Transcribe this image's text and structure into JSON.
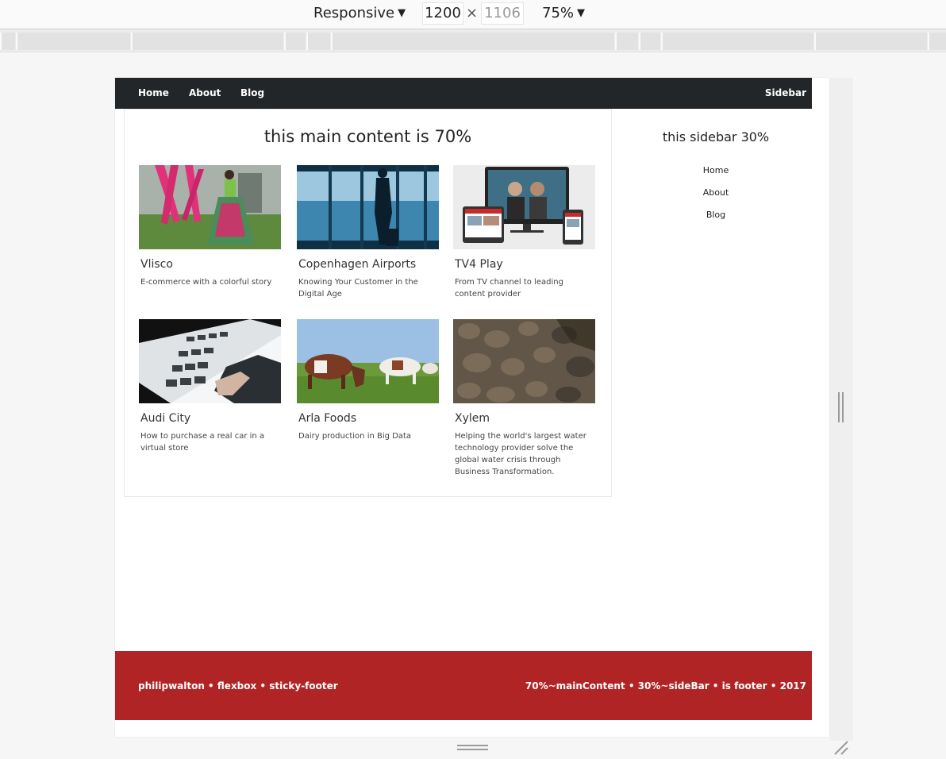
{
  "devtools": {
    "device_mode": "Responsive",
    "width": "1200",
    "times": "×",
    "height": "1106",
    "zoom": "75%",
    "caret": "▼"
  },
  "nav": {
    "home": "Home",
    "about": "About",
    "blog": "Blog",
    "sidebar": "Sidebar"
  },
  "main": {
    "title": "this main content is 70%",
    "cards": [
      {
        "title": "Vlisco",
        "desc": "E-commerce with a colorful story"
      },
      {
        "title": "Copenhagen Airports",
        "desc": "Knowing Your Customer in the Digital Age"
      },
      {
        "title": "TV4 Play",
        "desc": "From TV channel to leading content provider"
      },
      {
        "title": "Audi City",
        "desc": "How to purchase a real car in a virtual store"
      },
      {
        "title": "Arla Foods",
        "desc": "Dairy production in Big Data"
      },
      {
        "title": "Xylem",
        "desc": "Helping the world's largest water technology provider solve the global water crisis through Business Transformation."
      }
    ]
  },
  "sidebar": {
    "title": "this sidebar 30%",
    "links": [
      "Home",
      "About",
      "Blog"
    ]
  },
  "footer": {
    "left": "philipwalton • flexbox • sticky-footer",
    "right": "70%~mainContent • 30%~sideBar • is footer • 2017"
  },
  "colors": {
    "nav_bg": "#222628",
    "footer_bg": "#b12426"
  }
}
